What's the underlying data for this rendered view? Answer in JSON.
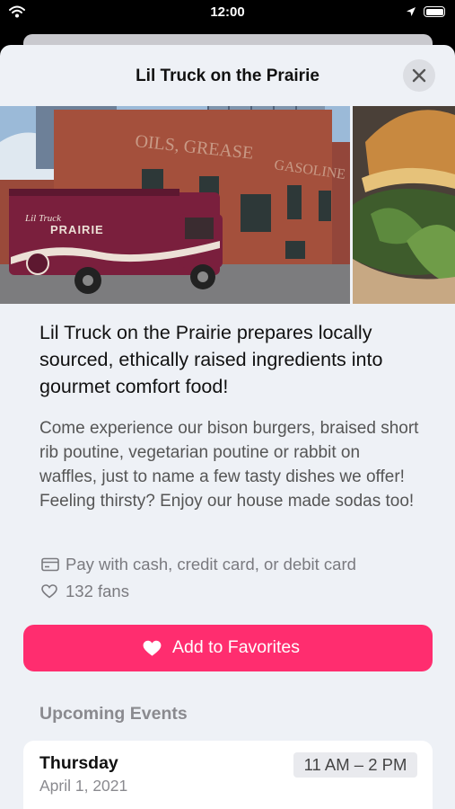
{
  "status_bar": {
    "time": "12:00"
  },
  "sheet": {
    "title": "Lil Truck on the Prairie",
    "close_label": "Close"
  },
  "truck_logo": {
    "line1": "Lil Truck",
    "line2": "PRAIRIE"
  },
  "details": {
    "headline": "Lil Truck on the Prairie prepares locally sourced, ethically raised ingredients into gourmet comfort food!",
    "description": "Come experience our bison burgers, braised short rib poutine, vegetarian poutine or rabbit on waffles, just to name a few tasty dishes we offer! Feeling thirsty? Enjoy our house made sodas too!",
    "payment": "Pay with cash, credit card, or debit card",
    "fans": "132 fans"
  },
  "actions": {
    "add_favorites": "Add to Favorites"
  },
  "events": {
    "section_title": "Upcoming Events",
    "items": [
      {
        "day": "Thursday",
        "date": "April 1, 2021",
        "time": "11 AM – 2 PM",
        "place": ""
      }
    ]
  },
  "colors": {
    "accent": "#ff2d6f",
    "sheet_bg": "#eef1f6",
    "truck": "#7a1f3d"
  }
}
